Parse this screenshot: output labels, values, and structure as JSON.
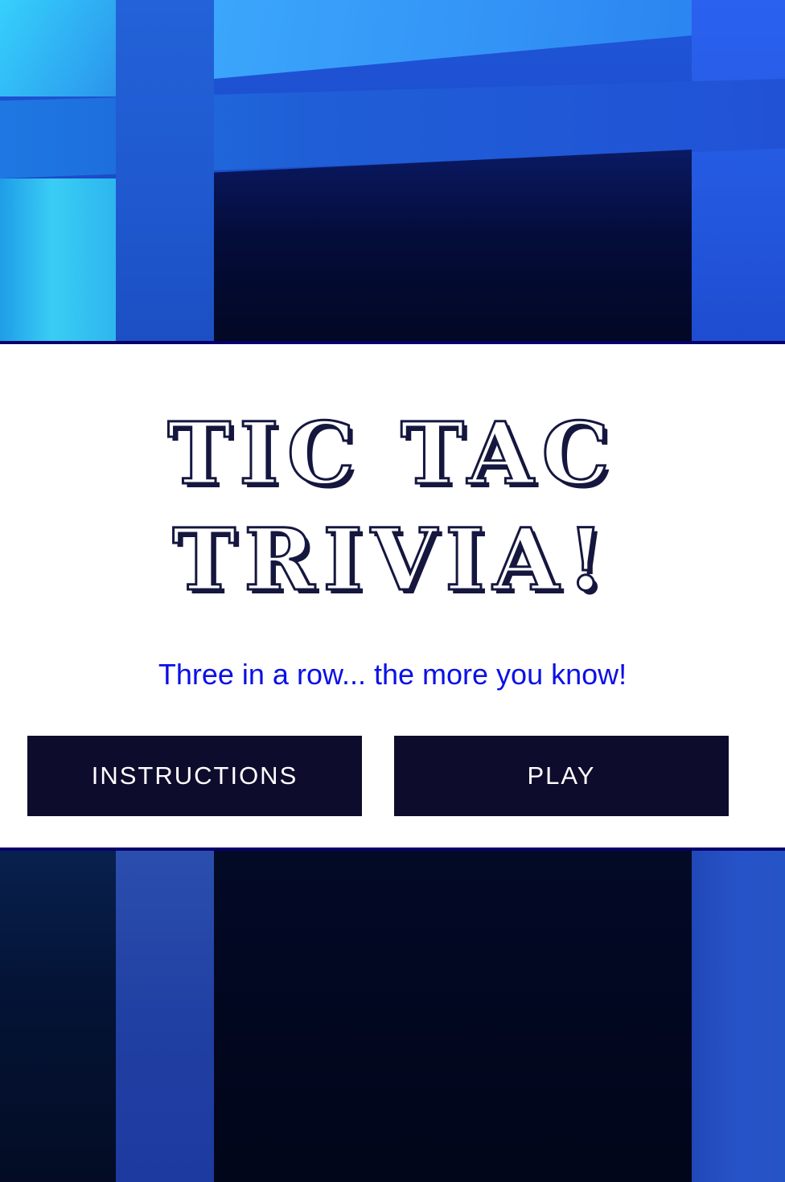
{
  "game": {
    "title_line1": "TIC TAC",
    "title_line2": "TRIVIA!",
    "tagline": "Three in a row... the more you know!"
  },
  "buttons": {
    "instructions_label": "INSTRUCTIONS",
    "play_label": "PLAY"
  },
  "colors": {
    "panel_border": "#06006b",
    "button_bg": "#0e0c2d",
    "tagline": "#0b10e6",
    "title_ink": "#15173f"
  }
}
